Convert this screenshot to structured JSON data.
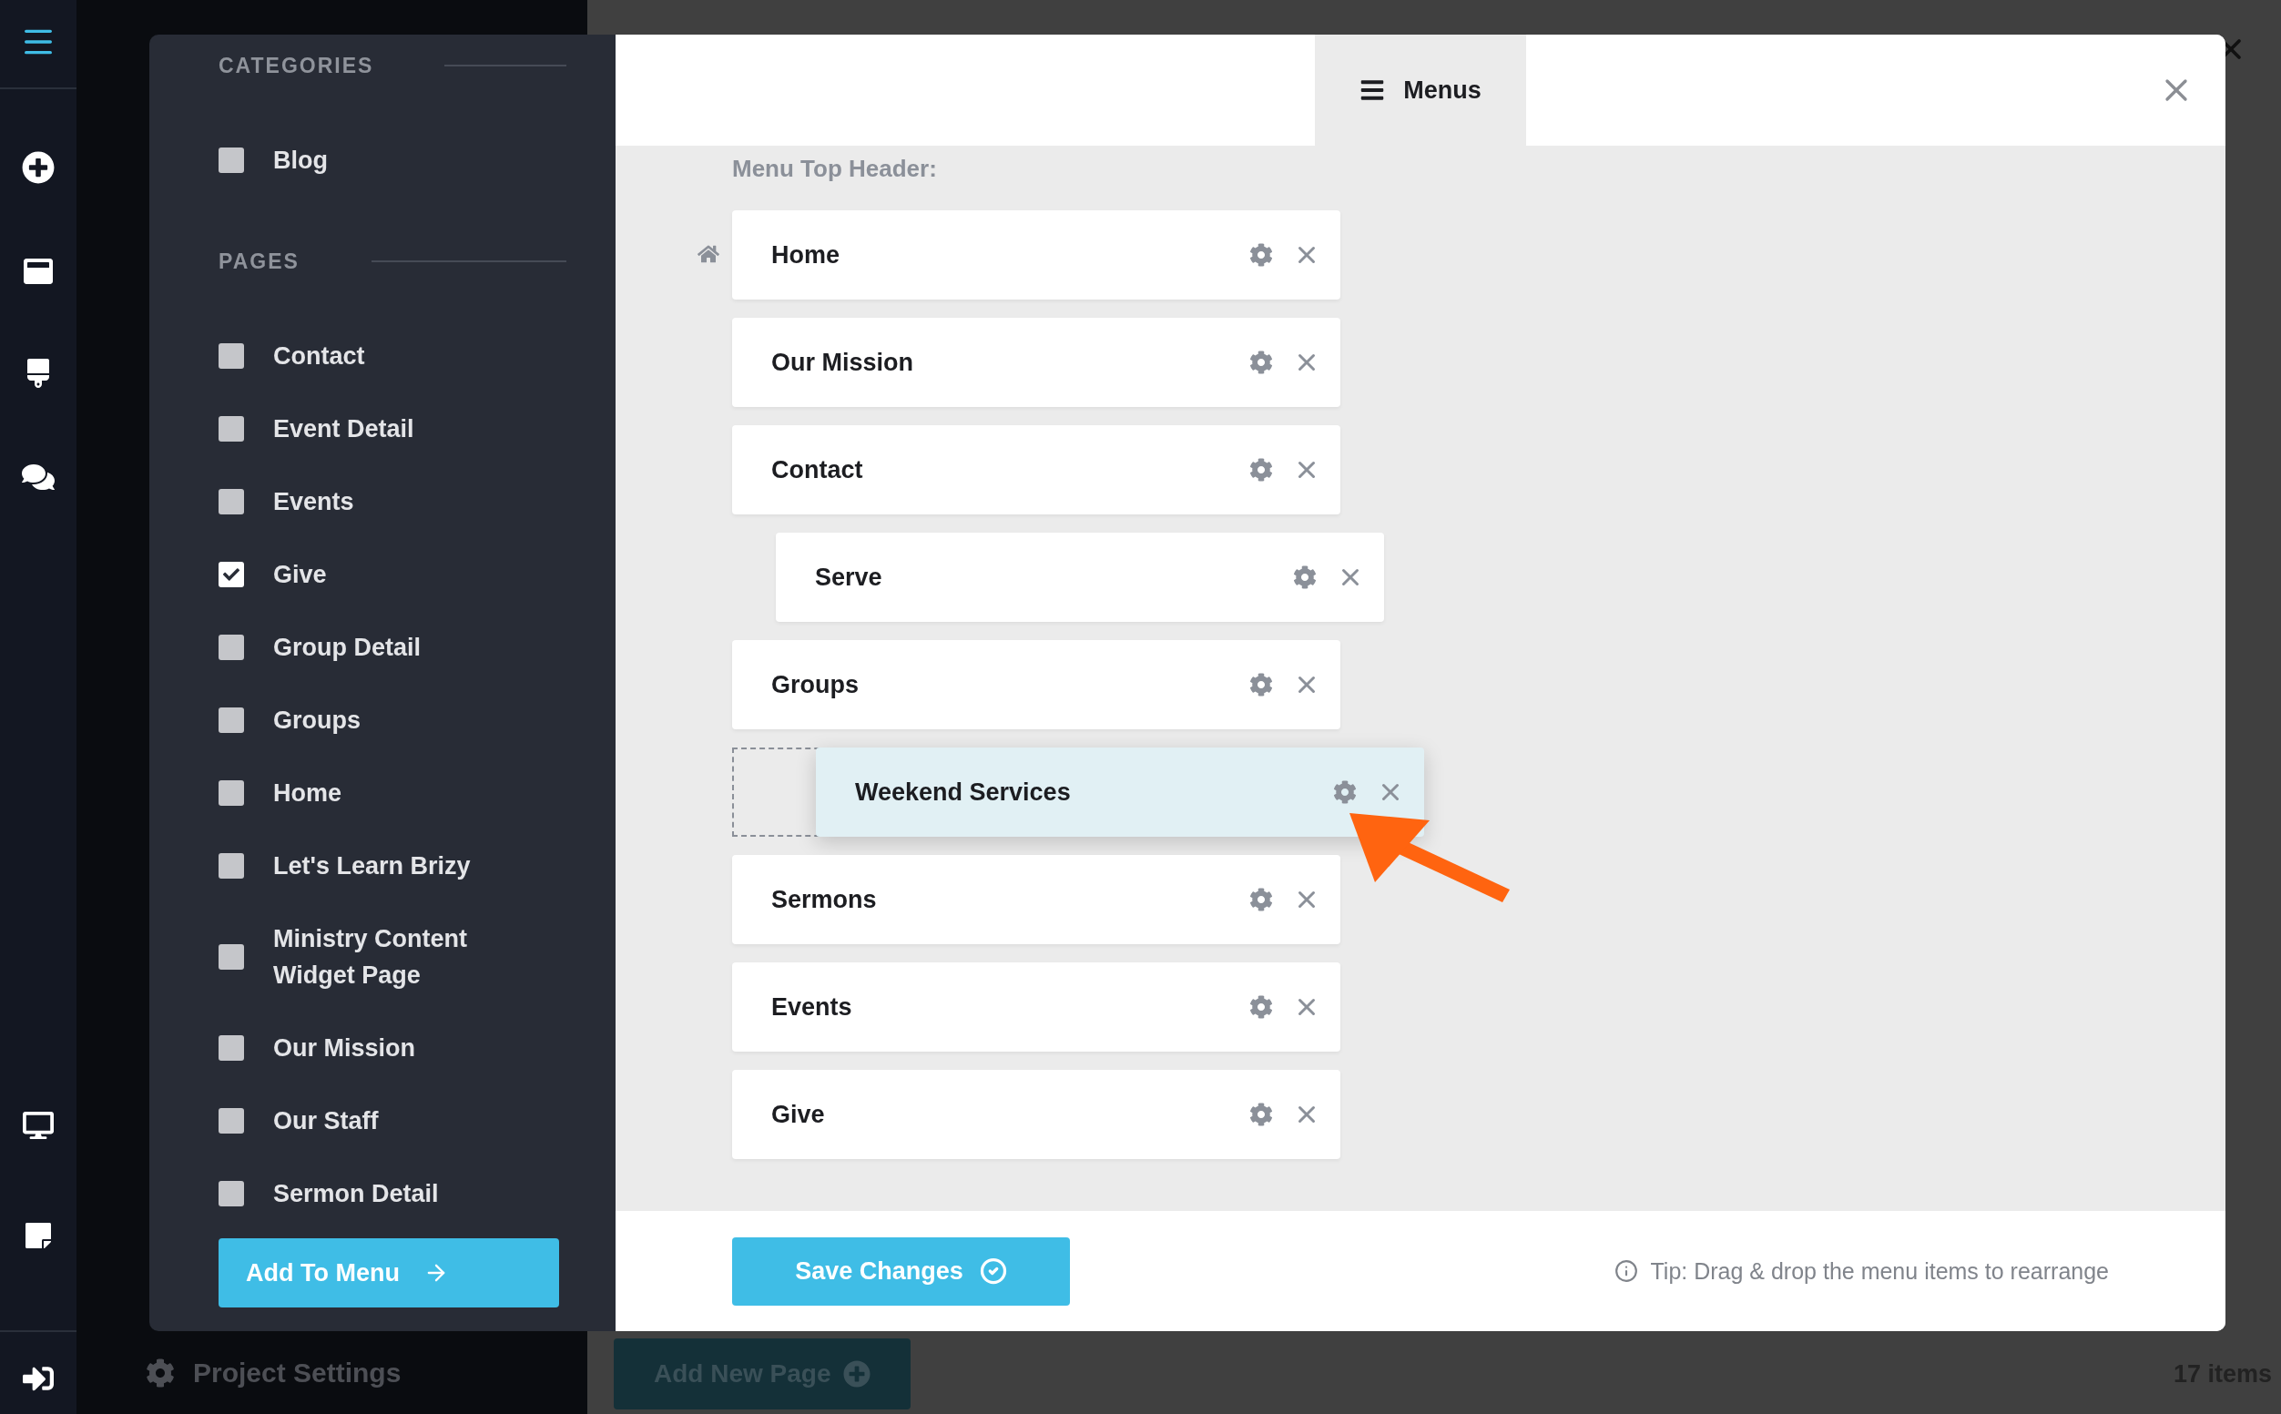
{
  "background": {
    "project_settings": "Project Settings",
    "add_page_button": "Add New Page",
    "item_count": "17 items"
  },
  "left_panel": {
    "sections": [
      {
        "title": "CATEGORIES",
        "items": [
          {
            "label": "Blog",
            "checked": false
          }
        ]
      },
      {
        "title": "PAGES",
        "items": [
          {
            "label": "Contact",
            "checked": false
          },
          {
            "label": "Event Detail",
            "checked": false
          },
          {
            "label": "Events",
            "checked": false
          },
          {
            "label": "Give",
            "checked": true
          },
          {
            "label": "Group Detail",
            "checked": false
          },
          {
            "label": "Groups",
            "checked": false
          },
          {
            "label": "Home",
            "checked": false
          },
          {
            "label": "Let's Learn Brizy",
            "checked": false
          },
          {
            "label": "Ministry Content Widget Page",
            "checked": false
          },
          {
            "label": "Our Mission",
            "checked": false
          },
          {
            "label": "Our Staff",
            "checked": false
          },
          {
            "label": "Sermon Detail",
            "checked": false
          }
        ]
      }
    ],
    "add_button": "Add To Menu"
  },
  "tabs": [
    {
      "label": "Menus",
      "selected": true
    }
  ],
  "menu": {
    "title": "Menu Top Header:",
    "items": [
      {
        "label": "Home",
        "home": true,
        "dragging": false
      },
      {
        "label": "Our Mission",
        "home": false,
        "dragging": false
      },
      {
        "label": "Contact",
        "home": false,
        "dragging": false,
        "children": [
          {
            "label": "Serve",
            "home": false,
            "dragging": false
          }
        ]
      },
      {
        "label": "Groups",
        "home": false,
        "dragging": false
      },
      {
        "label": "Weekend Services",
        "home": false,
        "dragging": true
      },
      {
        "label": "Sermons",
        "home": false,
        "dragging": false
      },
      {
        "label": "Events",
        "home": false,
        "dragging": false
      },
      {
        "label": "Give",
        "home": false,
        "dragging": false
      }
    ]
  },
  "save_button": "Save Changes",
  "tip": "Tip: Drag & drop the menu items to rearrange"
}
